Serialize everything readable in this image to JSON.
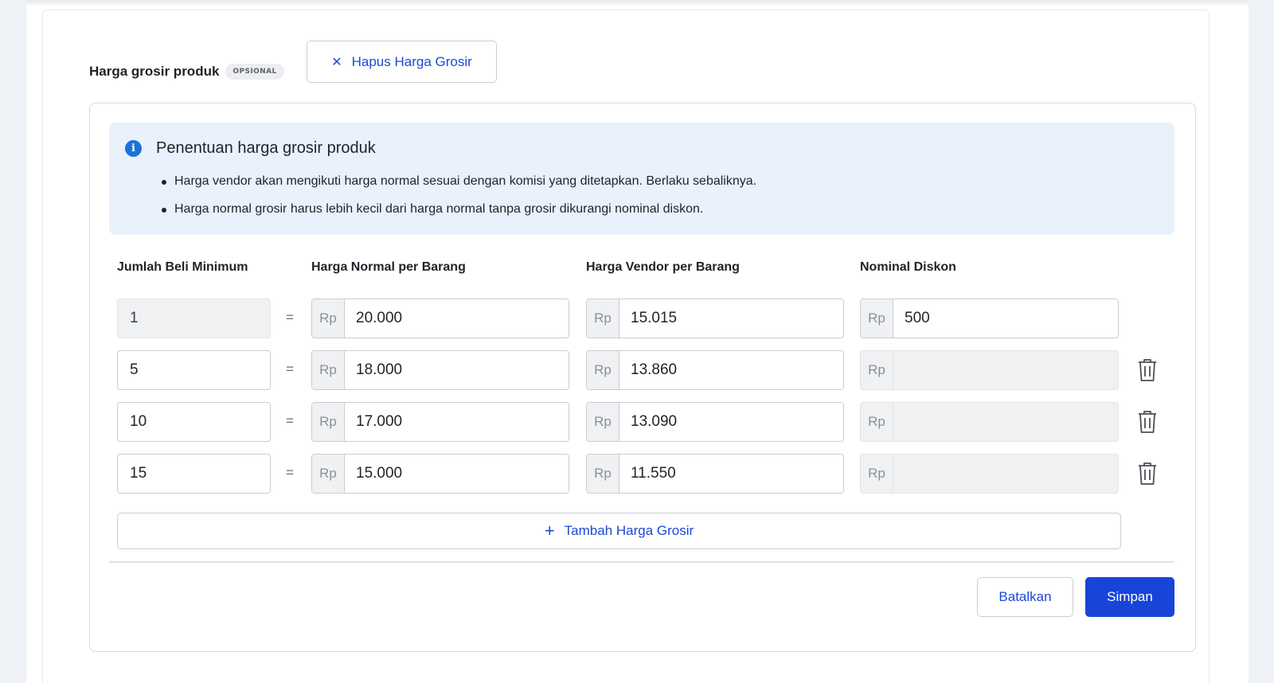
{
  "section": {
    "title": "Harga grosir produk",
    "badge": "OPSIONAL",
    "remove_button_label": "Hapus Harga Grosir"
  },
  "info": {
    "title": "Penentuan harga grosir produk",
    "bullets": [
      "Harga vendor akan mengikuti harga normal sesuai dengan komisi yang ditetapkan. Berlaku sebaliknya.",
      "Harga normal grosir harus lebih kecil dari harga normal tanpa grosir dikurangi nominal diskon."
    ]
  },
  "columns": {
    "qty": "Jumlah Beli Minimum",
    "normal": "Harga Normal per Barang",
    "vendor": "Harga Vendor per Barang",
    "diskon": "Nominal Diskon"
  },
  "currency": "Rp",
  "equals": "=",
  "rows": [
    {
      "qty": "1",
      "normal": "20.000",
      "vendor": "15.015",
      "diskon": "500"
    },
    {
      "qty": "5",
      "normal": "18.000",
      "vendor": "13.860",
      "diskon": ""
    },
    {
      "qty": "10",
      "normal": "17.000",
      "vendor": "13.090",
      "diskon": ""
    },
    {
      "qty": "15",
      "normal": "15.000",
      "vendor": "11.550",
      "diskon": ""
    }
  ],
  "add_button_label": "Tambah Harga Grosir",
  "footer": {
    "cancel_label": "Batalkan",
    "save_label": "Simpan"
  },
  "colors": {
    "accent": "#1844d8",
    "info_bg": "#e8f1fc",
    "info_icon": "#1a73d9"
  }
}
